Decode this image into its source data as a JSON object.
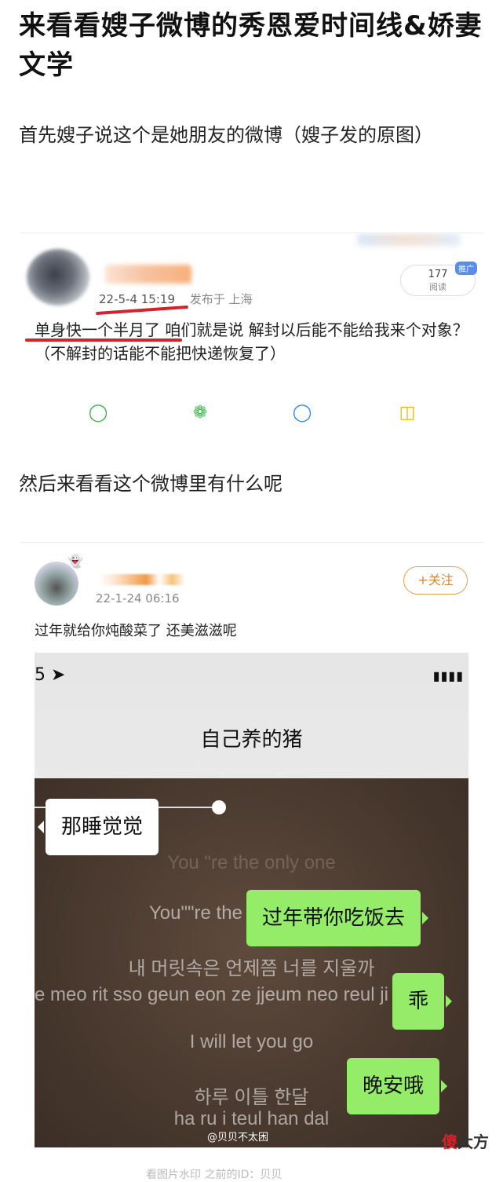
{
  "article": {
    "title": "来看看嫂子微博的秀恩爱时间线&娇妻文学",
    "para1": "首先嫂子说这个是她朋友的微博（嫂子发的原图）",
    "para2": "然后来看看这个微博里有什么呢"
  },
  "post1": {
    "date": "22-5-4 15:19",
    "location": "发布于 上海",
    "read_count": "177",
    "read_label": "阅读",
    "promo_tag": "推广",
    "text": "单身快一个半月了 咱们就是说 解封以后能不能给我来个对象？（不解封的话能不能把快递恢复了）",
    "share_icons": [
      "wechat-icon",
      "moments-icon",
      "qq-icon",
      "share-icon"
    ]
  },
  "post2": {
    "date": "22-1-24 06:16",
    "follow_label": "+关注",
    "text": "过年就给你炖酸菜了 还美滋滋呢",
    "screenshot": {
      "chat_title": "自己养的猪",
      "bubbles": {
        "left": "那睡觉觉",
        "right1": "过年带你吃饭去",
        "right2": "乖",
        "right3": "晚安哦"
      },
      "lyrics": [
        "You \"re the only one",
        "You\"\"re the only one",
        "내 머릿속은 언제쯤 너를 지울까",
        "e meo rit sso geun eon ze jjeum neo reul ji ul kka",
        "I will let you go",
        "하루 이틀 한달",
        "ha ru i teul han dal"
      ],
      "watermark": "@贝贝不太困"
    }
  },
  "footer": {
    "text": "看图片水印 之前的ID：贝贝",
    "site_logo_prefix": "傻",
    "site_logo_suffix": "大方"
  }
}
